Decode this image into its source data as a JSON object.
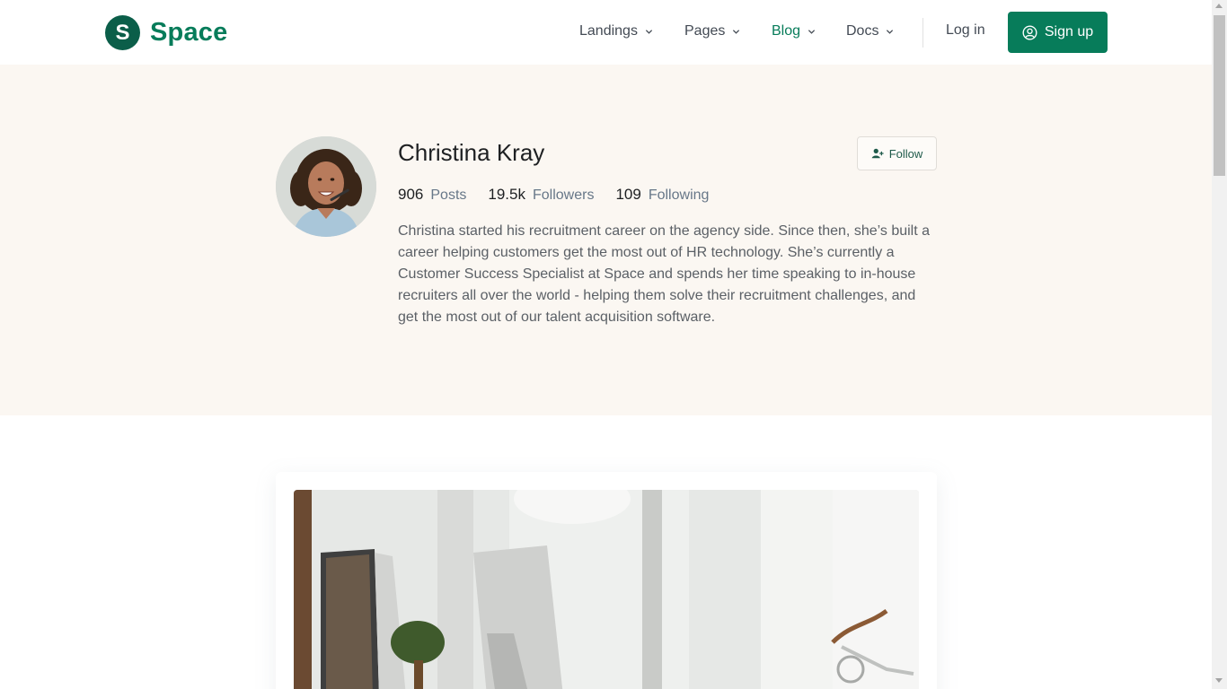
{
  "brand": {
    "initial": "S",
    "name": "Space",
    "color": "#077c5a",
    "mark_color": "#0b5e49"
  },
  "nav": {
    "items": [
      {
        "label": "Landings",
        "active": false
      },
      {
        "label": "Pages",
        "active": false
      },
      {
        "label": "Blog",
        "active": true
      },
      {
        "label": "Docs",
        "active": false
      }
    ],
    "login_label": "Log in",
    "signup_label": "Sign up"
  },
  "profile": {
    "name": "Christina Kray",
    "follow_label": "Follow",
    "stats": [
      {
        "value": "906",
        "label": "Posts"
      },
      {
        "value": "19.5k",
        "label": "Followers"
      },
      {
        "value": "109",
        "label": "Following"
      }
    ],
    "bio": "Christina started his recruitment career on the agency side. Since then, she’s built a career helping customers get the most out of HR technology. She’s currently a Customer Success Specialist at Space and spends her time speaking to in-house recruiters all over the world - helping them solve their recruitment challenges, and get the most out of our talent acquisition software."
  },
  "icons": {
    "chevron": "chevron-down-icon",
    "user": "user-circle-icon",
    "follow": "user-plus-icon"
  },
  "colors": {
    "accent": "#077c5a",
    "hero_bg": "#fbf7f2",
    "text_muted": "#677788"
  }
}
